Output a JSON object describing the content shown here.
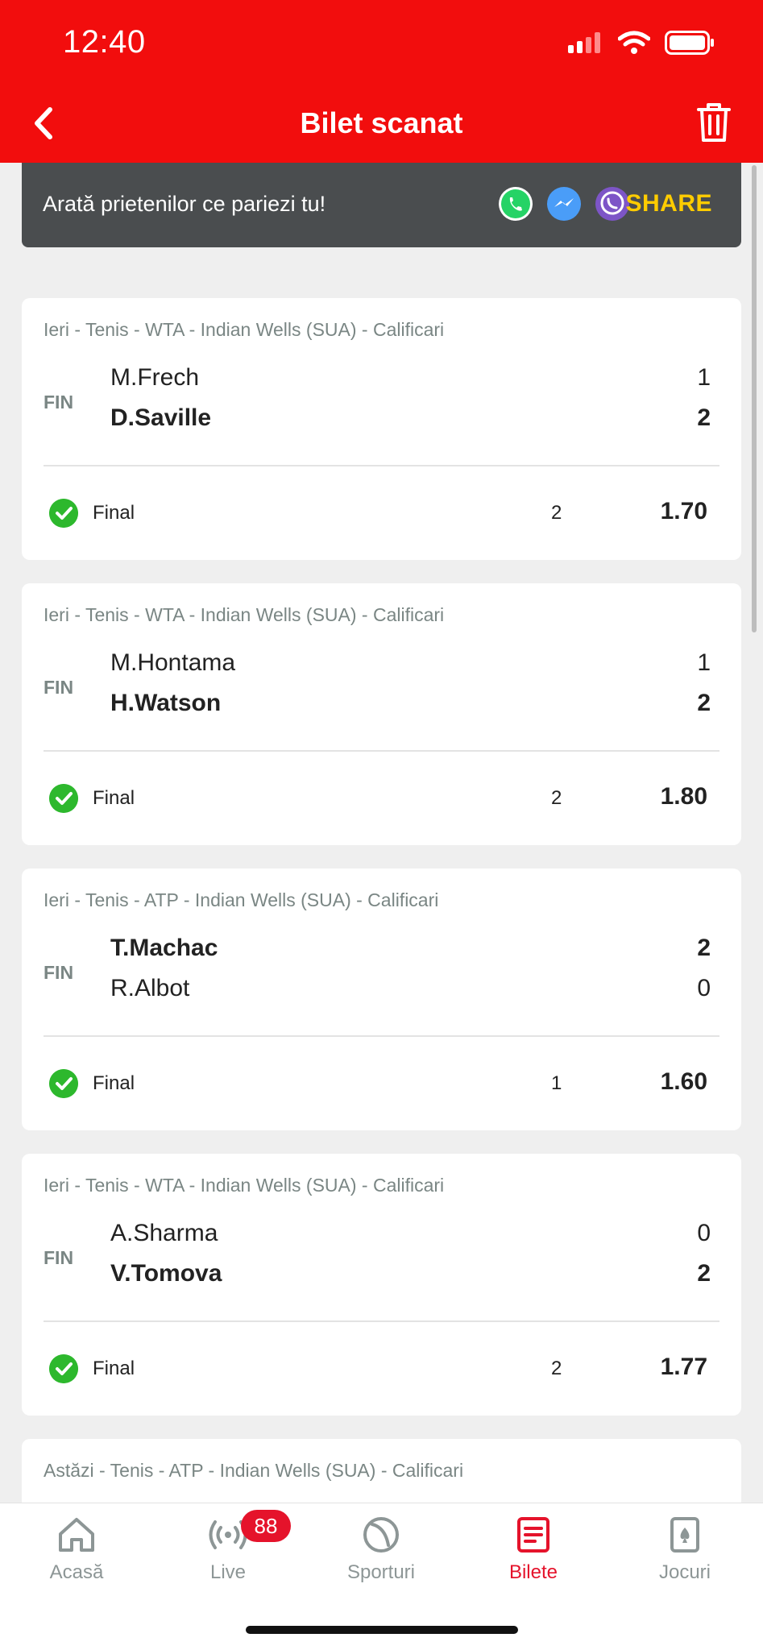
{
  "status_bar": {
    "time": "12:40"
  },
  "header": {
    "title": "Bilet scanat"
  },
  "share_banner": {
    "text": "Arată prietenilor ce pariezi tu!",
    "button": "SHARE"
  },
  "bets": [
    {
      "meta": "Ieri - Tenis - WTA - Indian Wells (SUA) - Calificari",
      "status": "FIN",
      "team1": "M.Frech",
      "score1": "1",
      "team2": "D.Saville",
      "score2": "2",
      "market": "Final",
      "pick": "2",
      "odds": "1.70"
    },
    {
      "meta": "Ieri - Tenis - WTA - Indian Wells (SUA) - Calificari",
      "status": "FIN",
      "team1": "M.Hontama",
      "score1": "1",
      "team2": "H.Watson",
      "score2": "2",
      "market": "Final",
      "pick": "2",
      "odds": "1.80"
    },
    {
      "meta": "Ieri - Tenis - ATP - Indian Wells (SUA) - Calificari",
      "status": "FIN",
      "team1": "T.Machac",
      "score1": "2",
      "team2": "R.Albot",
      "score2": "0",
      "market": "Final",
      "pick": "1",
      "odds": "1.60"
    },
    {
      "meta": "Ieri - Tenis - WTA - Indian Wells (SUA) - Calificari",
      "status": "FIN",
      "team1": "A.Sharma",
      "score1": "0",
      "team2": "V.Tomova",
      "score2": "2",
      "market": "Final",
      "pick": "2",
      "odds": "1.77"
    },
    {
      "meta": "Astăzi - Tenis - ATP - Indian Wells (SUA) - Calificari"
    }
  ],
  "bottom_nav": {
    "items": [
      {
        "label": "Acasă",
        "icon": "home-icon"
      },
      {
        "label": "Live",
        "icon": "live-icon",
        "badge": "88"
      },
      {
        "label": "Sporturi",
        "icon": "ball-icon"
      },
      {
        "label": "Bilete",
        "icon": "ticket-icon",
        "active": true
      },
      {
        "label": "Jocuri",
        "icon": "cards-icon"
      }
    ]
  },
  "colors": {
    "brand_red": "#f20d0d",
    "accent_yellow": "#ffcc00",
    "win_green": "#2db82d"
  }
}
